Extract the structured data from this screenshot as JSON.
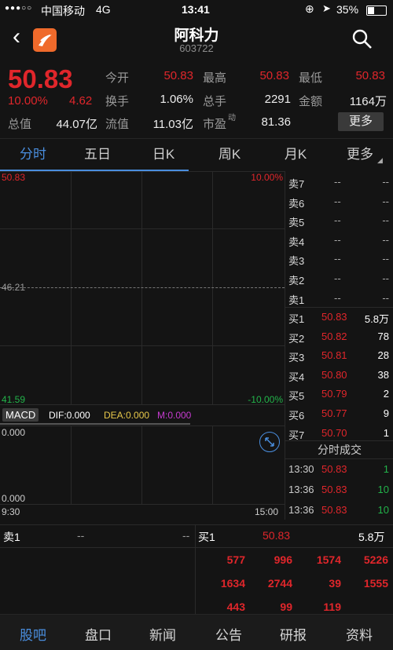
{
  "status": {
    "signal": "●●●○○",
    "carrier": "中国移动",
    "network": "4G",
    "time": "13:41",
    "battery": "35%"
  },
  "nav": {
    "title": "阿科力",
    "code": "603722"
  },
  "quote": {
    "price": "50.83",
    "change_pct": "10.00%",
    "change_amt": "4.62",
    "open_label": "今开",
    "open": "50.83",
    "high_label": "最高",
    "high": "50.83",
    "low_label": "最低",
    "low": "50.83",
    "turnover_label": "换手",
    "turnover": "1.06%",
    "volume_label": "总手",
    "volume": "2291",
    "amount_label": "金额",
    "amount": "1164万",
    "mktcap_label": "总值",
    "mktcap": "44.07亿",
    "float_label": "流值",
    "float": "11.03亿",
    "pe_label": "市盈",
    "pe_sup": "动",
    "pe": "81.36",
    "more_button": "更多"
  },
  "tabs": [
    "分时",
    "五日",
    "日K",
    "周K",
    "月K",
    "更多"
  ],
  "chart": {
    "y_top": "50.83",
    "y_mid": "46.21",
    "y_bottom": "41.59",
    "pct_top": "10.00%",
    "pct_bottom": "-10.00%",
    "macd_label": "MACD",
    "dif": "DIF:0.000",
    "dea": "DEA:0.000",
    "m": "M:0.000",
    "macd_top": "0.000",
    "macd_bottom": "0.000",
    "time_start": "9:30",
    "time_end": "15:00"
  },
  "book": {
    "sell": [
      {
        "label": "卖7",
        "price": "--",
        "vol": "--"
      },
      {
        "label": "卖6",
        "price": "--",
        "vol": "--"
      },
      {
        "label": "卖5",
        "price": "--",
        "vol": "--"
      },
      {
        "label": "卖4",
        "price": "--",
        "vol": "--"
      },
      {
        "label": "卖3",
        "price": "--",
        "vol": "--"
      },
      {
        "label": "卖2",
        "price": "--",
        "vol": "--"
      },
      {
        "label": "卖1",
        "price": "--",
        "vol": "--"
      }
    ],
    "buy": [
      {
        "label": "买1",
        "price": "50.83",
        "vol": "5.8万"
      },
      {
        "label": "买2",
        "price": "50.82",
        "vol": "78"
      },
      {
        "label": "买3",
        "price": "50.81",
        "vol": "28"
      },
      {
        "label": "买4",
        "price": "50.80",
        "vol": "38"
      },
      {
        "label": "买5",
        "price": "50.79",
        "vol": "2"
      },
      {
        "label": "买6",
        "price": "50.77",
        "vol": "9"
      },
      {
        "label": "买7",
        "price": "50.70",
        "vol": "1"
      }
    ],
    "ticks_title": "分时成交",
    "ticks": [
      {
        "time": "13:30",
        "price": "50.83",
        "vol": "1"
      },
      {
        "time": "13:36",
        "price": "50.83",
        "vol": "10"
      },
      {
        "time": "13:36",
        "price": "50.83",
        "vol": "10"
      }
    ]
  },
  "level2": {
    "sell1_label": "卖1",
    "sell1_price": "--",
    "sell1_vol": "--",
    "buy1_label": "买1",
    "buy1_price": "50.83",
    "buy1_vol": "5.8万",
    "queue": [
      [
        "577",
        "996",
        "1574",
        "5226"
      ],
      [
        "1634",
        "2744",
        "39",
        "1555"
      ],
      [
        "443",
        "99",
        "119",
        ""
      ]
    ]
  },
  "bottom": [
    "股吧",
    "盘口",
    "新闻",
    "公告",
    "研报",
    "资料"
  ],
  "colors": {
    "up": "#e0262b",
    "down": "#22b34a",
    "accent": "#4a8ede",
    "bg": "#141414"
  }
}
